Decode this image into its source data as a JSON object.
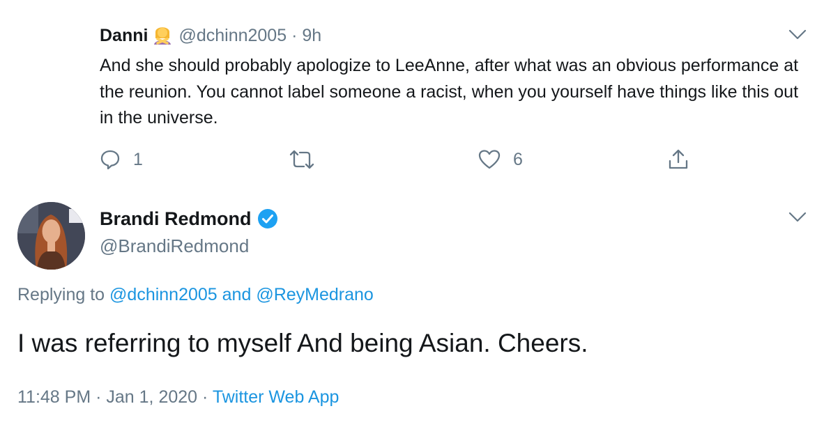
{
  "reply_tweet": {
    "display_name": "Danni",
    "emoji_icon": "woman-gesturing-emoji-icon",
    "handle": "@dchinn2005",
    "separator": "·",
    "time": "9h",
    "text": "And she should probably apologize to LeeAnne, after what was an obvious performance at the reunion. You cannot label someone a racist, when you yourself have things like this out in the universe.",
    "actions": {
      "reply_count": "1",
      "retweet_count": "",
      "like_count": "6"
    }
  },
  "main_tweet": {
    "display_name": "Brandi Redmond",
    "verified_icon": "verified-badge-icon",
    "handle": "@BrandiRedmond",
    "replying_prefix": "Replying to",
    "reply_to_1": "@dchinn2005",
    "reply_and": "and",
    "reply_to_2": "@ReyMedrano",
    "text": "I was referring to myself And being Asian. Cheers.",
    "time": "11:48 PM",
    "separator": "·",
    "date": "Jan 1, 2020",
    "source": "Twitter Web App"
  },
  "colors": {
    "text": "#14171a",
    "secondary": "#657786",
    "link": "#1b95e0",
    "verified": "#1da1f2"
  }
}
